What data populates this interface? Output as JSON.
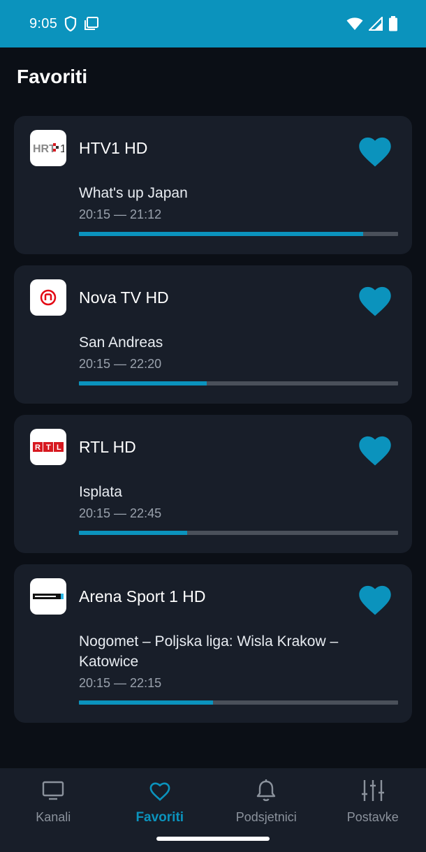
{
  "status_bar": {
    "time": "9:05",
    "icons_left": [
      "shield-icon",
      "clipboard-icon"
    ],
    "icons_right": [
      "wifi-icon",
      "signal-icon",
      "battery-icon"
    ],
    "color": "#0b93bd"
  },
  "page": {
    "title": "Favoriti"
  },
  "favorites": [
    {
      "channel": "HTV1 HD",
      "logo": "htv1-logo",
      "program": "What's up Japan",
      "time_range": "20:15 — 21:12",
      "progress": 0.89
    },
    {
      "channel": "Nova TV HD",
      "logo": "nova-tv-logo",
      "program": "San Andreas",
      "time_range": "20:15 — 22:20",
      "progress": 0.4
    },
    {
      "channel": "RTL HD",
      "logo": "rtl-logo",
      "program": "Isplata",
      "time_range": "20:15 — 22:45",
      "progress": 0.34
    },
    {
      "channel": "Arena Sport 1 HD",
      "logo": "arena-sport-logo",
      "program": "Nogomet – Poljska liga: Wisla Krakow – Katowice",
      "time_range": "20:15 — 22:15",
      "progress": 0.42
    }
  ],
  "bottom_nav": [
    {
      "label": "Kanali",
      "icon": "tv-icon",
      "active": false
    },
    {
      "label": "Favoriti",
      "icon": "heart-icon",
      "active": true
    },
    {
      "label": "Podsjetnici",
      "icon": "bell-icon",
      "active": false
    },
    {
      "label": "Postavke",
      "icon": "sliders-icon",
      "active": false
    }
  ],
  "colors": {
    "accent": "#0b93bd",
    "background": "#0b0f16",
    "card": "#181e29",
    "progress_track": "#4a505a"
  }
}
